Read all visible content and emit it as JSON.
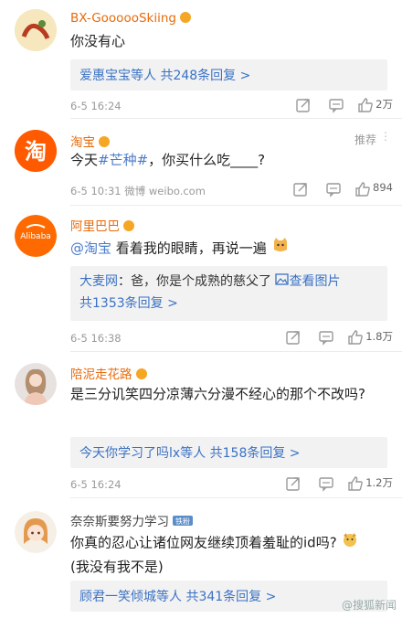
{
  "comments": [
    {
      "name": "BX-GoooooSkiing",
      "text": "你没有心",
      "reply_summary": "爱惠宝宝等人 共248条回复 >",
      "time": "6-5 16:24",
      "likes": "2万"
    },
    {
      "name": "淘宝",
      "text_pre": "今天",
      "text_link": "#芒种#",
      "text_post": "，你买什么吃____?",
      "recommend": "推荐",
      "time": "6-5 10:31 微博 weibo.com",
      "likes": "894"
    },
    {
      "name": "阿里巴巴",
      "text_link": "@淘宝",
      "text_post": " 看着我的眼睛，再说一遍",
      "reply_author": "大麦网",
      "reply_text": "：爸，你是个成熟的慈父了",
      "reply_image_link": "查看图片",
      "reply_count": "共1353条回复 >",
      "time": "6-5 16:38",
      "likes": "1.8万"
    },
    {
      "name": "陪泥走花路",
      "text": "是三分讥笑四分凉薄六分漫不经心的那个不改吗?",
      "reply_summary": "今天你学习了吗lx等人 共158条回复 >",
      "time": "6-5 16:24",
      "likes": "1.2万"
    },
    {
      "name": "奈奈斯要努力学习",
      "text": "你真的忍心让诸位网友继续顶着羞耻的id吗?",
      "text2": "(我没有我不是)",
      "reply_summary": "顾君一笑倾城等人 共341条回复 >",
      "tag": "铁粉"
    }
  ],
  "watermark": "@搜狐新闻",
  "icons": [
    "share-icon",
    "comment-icon",
    "like-icon"
  ],
  "colors": {
    "name": "#e86b0c",
    "link": "#3b72c4",
    "meta": "#9a9a9a"
  }
}
